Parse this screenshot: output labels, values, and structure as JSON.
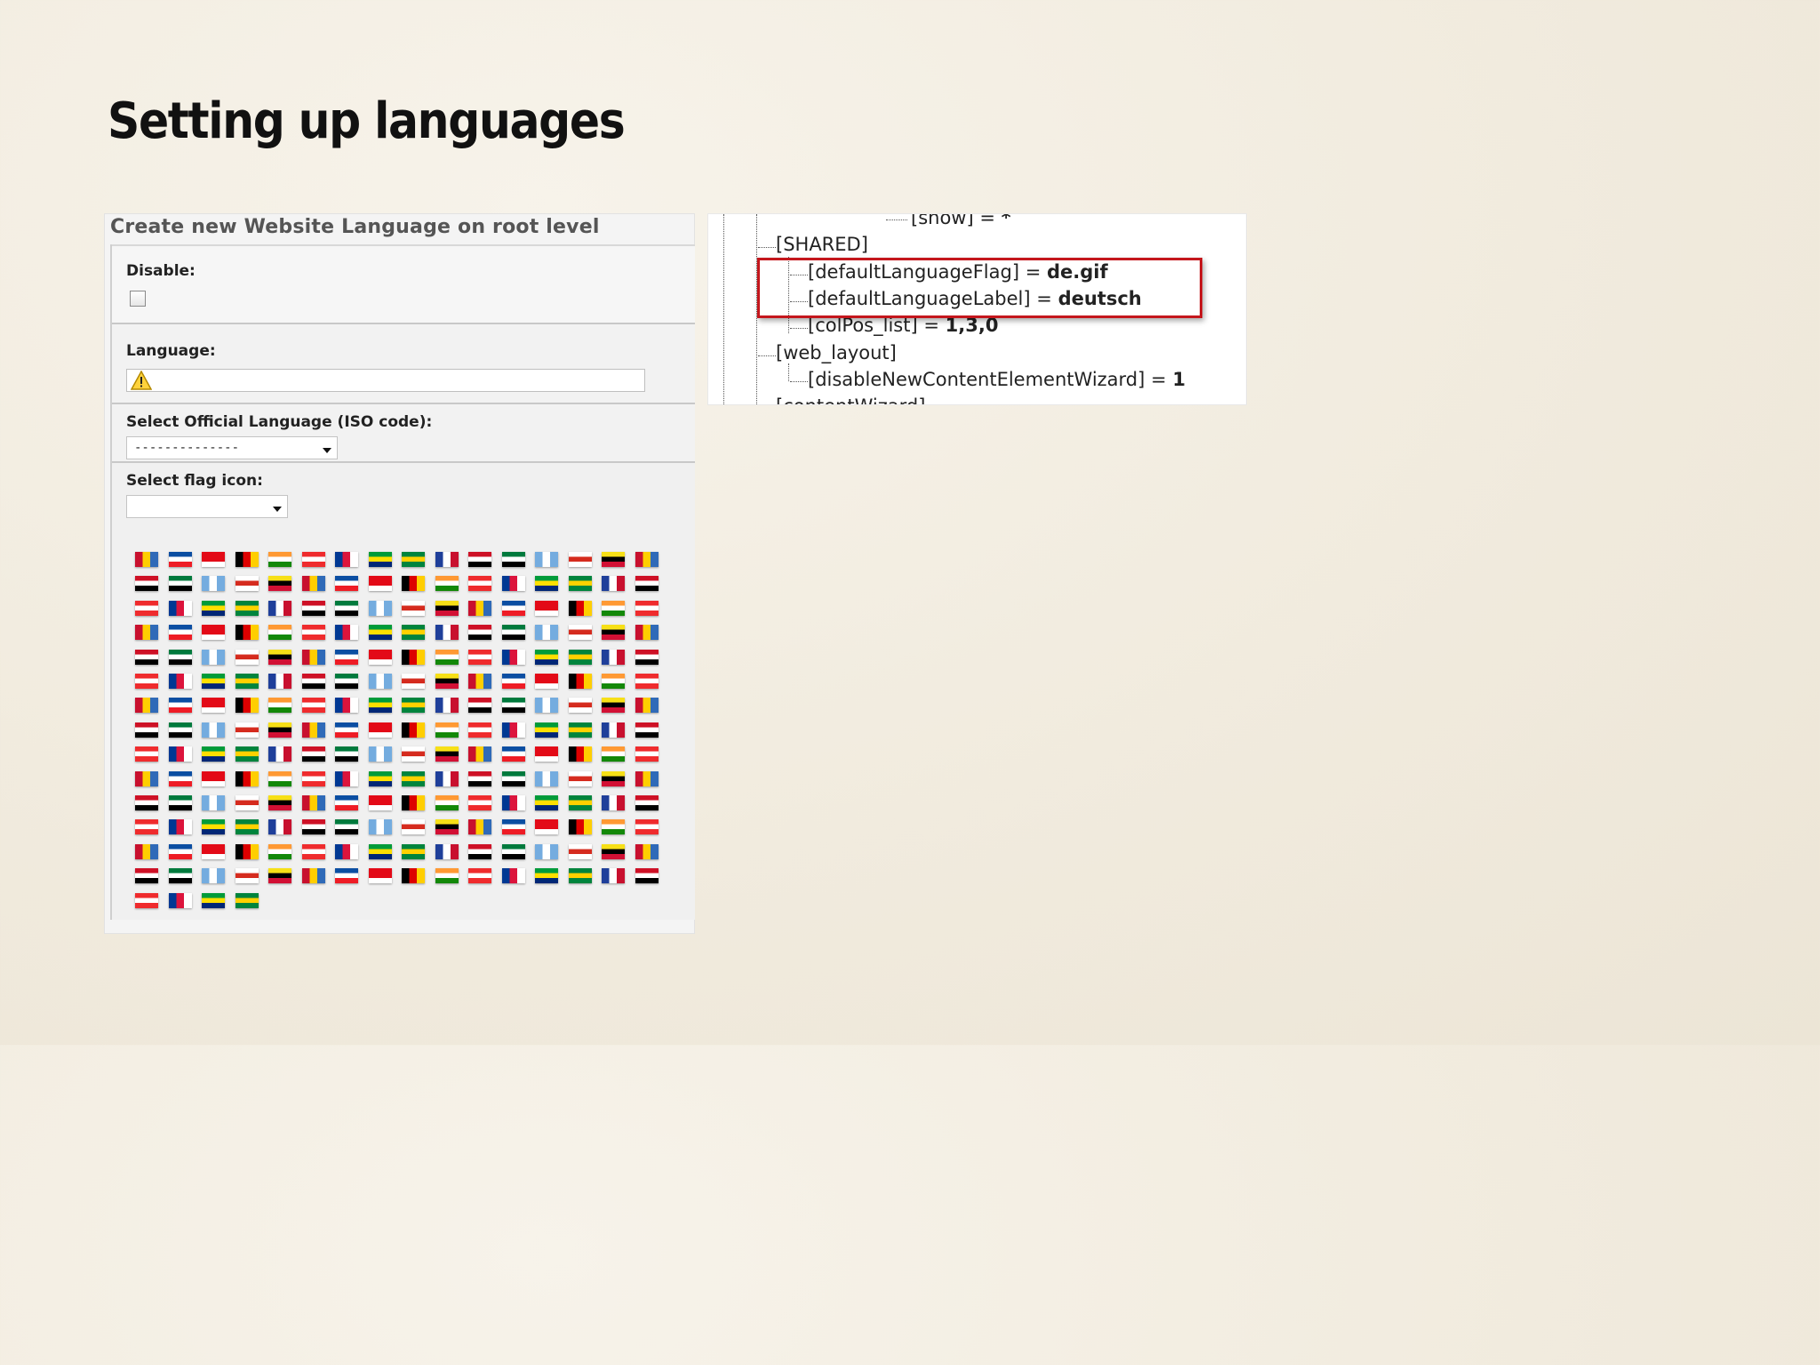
{
  "slide": {
    "title": "Setting up languages"
  },
  "language_form": {
    "header": "Create new Website Language on root level",
    "disable_label": "Disable:",
    "language_label": "Language:",
    "language_value": "",
    "iso_label": "Select Official Language (ISO code):",
    "iso_selected": "--------------",
    "flag_label": "Select flag icon:",
    "flag_selected": "",
    "flag_count": 228,
    "flag_palette": [
      [
        "#c8102e",
        "#ffce00",
        "#2f6ab8"
      ],
      [
        "#ffffff",
        "#d52b1e",
        "#ffffff"
      ],
      [
        "#007a3d",
        "#ffffff",
        "#000000"
      ],
      [
        "#1f3f9a",
        "#ffffff",
        "#c8102e"
      ],
      [
        "#009b3a",
        "#fedf00",
        "#002776"
      ],
      [
        "#ef2b2d",
        "#ffffff",
        "#ef2b2d"
      ],
      [
        "#000000",
        "#dd0000",
        "#ffce00"
      ],
      [
        "#0b4ea2",
        "#ffffff",
        "#ee1c25"
      ],
      [
        "#f7e017",
        "#000000",
        "#d21034"
      ],
      [
        "#74acdf",
        "#ffffff",
        "#74acdf"
      ],
      [
        "#ce1126",
        "#ffffff",
        "#000000"
      ],
      [
        "#00843d",
        "#ffd100",
        "#00843d"
      ],
      [
        "#003893",
        "#dc143c",
        "#ffffff"
      ],
      [
        "#ff9933",
        "#ffffff",
        "#138808"
      ],
      [
        "#e30a17",
        "#e30a17",
        "#ffffff"
      ]
    ]
  },
  "ts_tree": {
    "lines": [
      {
        "key": "[snow]",
        "value": "*"
      },
      {
        "key": "[SHARED]",
        "value": ""
      },
      {
        "key": "[defaultLanguageFlag]",
        "value": "de.gif"
      },
      {
        "key": "[defaultLanguageLabel]",
        "value": "deutsch"
      },
      {
        "key": "[colPos_list]",
        "value": "1,3,0"
      },
      {
        "key": "[web_layout]",
        "value": ""
      },
      {
        "key": "[disableNewContentElementWizard]",
        "value": "1"
      },
      {
        "key": "[contentWizard]",
        "value": ""
      }
    ],
    "equals": "="
  },
  "colors": {
    "highlight_border": "#c4161c",
    "header_text": "#555555"
  }
}
